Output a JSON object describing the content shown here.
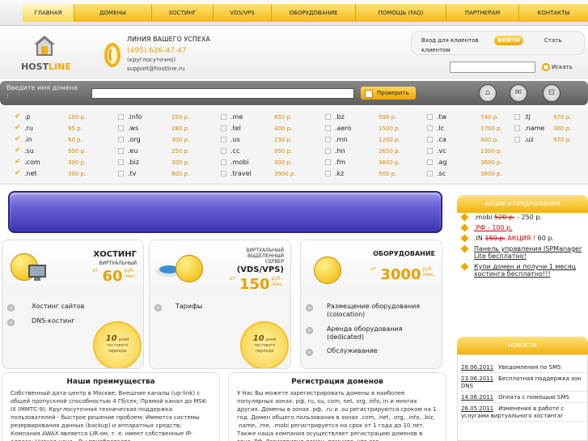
{
  "nav": {
    "items": [
      {
        "label": "ГЛАВНАЯ",
        "active": true
      },
      {
        "label": "ДОМЕНЫ"
      },
      {
        "label": "ХОСТИНГ"
      },
      {
        "label": "VDS/VPS"
      },
      {
        "label": "ОБОРУДОВАНИЕ"
      },
      {
        "label": "ПОМОЩЬ (FAQ)"
      },
      {
        "label": "ПАРТНЕРАМ"
      },
      {
        "label": "КОНТАКТЫ"
      }
    ]
  },
  "header": {
    "logo_text_a": "HOST",
    "logo_text_b": "LINE",
    "slogan": "ЛИНИЯ ВАШЕГО УСПЕХА",
    "phone": "(495) 626-47-47",
    "phone_note": "(круглосуточно)",
    "support_email": "support@hostline.ru",
    "login_label_1": "Вход для клиентов",
    "login_label_2": "клиентом",
    "login_button": "ВОЙТИ",
    "become_client": "Стать",
    "search_button": "Искать",
    "search_value": ""
  },
  "domain_check": {
    "placeholder_1": "Введите имя домена",
    "placeholder_2": ":",
    "check_button": "Проверить",
    "input_value": ""
  },
  "zones": [
    [
      {
        "name": ".p",
        "price": "100 р.",
        "checked": true
      },
      {
        "name": ".ru",
        "price": "95 р.",
        "checked": true
      },
      {
        "name": ".in",
        "price": "60 р.",
        "checked": true
      },
      {
        "name": ".su",
        "price": "950 р.",
        "checked": true
      },
      {
        "name": ".com",
        "price": "300 р.",
        "checked": true
      },
      {
        "name": ".net",
        "price": "300 р.",
        "checked": true
      }
    ],
    [
      {
        "name": ".info",
        "price": "250 р."
      },
      {
        "name": ".ws",
        "price": "280 р."
      },
      {
        "name": ".org",
        "price": "300 р."
      },
      {
        "name": ".eu",
        "price": "250 р."
      },
      {
        "name": ".biz",
        "price": "300 р."
      },
      {
        "name": ".tv",
        "price": "800 р."
      }
    ],
    [
      {
        "name": ".me",
        "price": "650 р."
      },
      {
        "name": ".tel",
        "price": "400 р."
      },
      {
        "name": ".us",
        "price": "230 р."
      },
      {
        "name": ".cc",
        "price": "950 р."
      },
      {
        "name": ".mobi",
        "price": "300 р."
      },
      {
        "name": ".travel",
        "price": "3900 р."
      }
    ],
    [
      {
        "name": ".bz",
        "price": "590 р."
      },
      {
        "name": ".aero",
        "price": "1500 р."
      },
      {
        "name": ".mn",
        "price": "1200 р."
      },
      {
        "name": ".hn",
        "price": "2650 р."
      },
      {
        "name": ".fm",
        "price": "3600 р."
      },
      {
        "name": ".kz",
        "price": "500 р."
      }
    ],
    [
      {
        "name": ".tw",
        "price": "740 р."
      },
      {
        "name": ".lc",
        "price": "1700 р."
      },
      {
        "name": ".ca",
        "price": "400 р."
      },
      {
        "name": ".vc",
        "price": "1300 р."
      },
      {
        "name": ".ag",
        "price": "3600 р."
      },
      {
        "name": ".sc",
        "price": "3600 р."
      }
    ],
    [
      {
        "name": ".tj",
        "price": "970 р."
      },
      {
        "name": ".name",
        "price": "300 р."
      },
      {
        "name": ".uz",
        "price": "970 р."
      }
    ]
  ],
  "products": {
    "hosting": {
      "title": "ХОСТИНГ",
      "sub": "ВИРТУАЛЬНЫЙ",
      "from": "от",
      "price": "60",
      "unit_1": "руб.",
      "unit_2": "/мес.",
      "links": [
        "Хостинг сайтов",
        "DNS-костинг"
      ],
      "badge_num": "10",
      "badge_text_1": "дней",
      "badge_text_2": "тестового",
      "badge_text_3": "периода"
    },
    "vds": {
      "sub_1": "ВИРТУАЛЬНЫЙ",
      "sub_2": "ВЫДЕЛЕННЫЙ",
      "sub_3": "СЕРВЕР",
      "title": "(VDS/VPS)",
      "from": "от",
      "price": "150",
      "unit_1": "руб.",
      "unit_2": "/мес.",
      "links": [
        "Тарифы"
      ],
      "badge_num": "10",
      "badge_text_1": "дней",
      "badge_text_2": "тестового",
      "badge_text_3": "периода"
    },
    "hardware": {
      "title": "ОБОРУДОВАНИЕ",
      "from": "от",
      "price": "3000",
      "unit_1": "руб.",
      "unit_2": "/мес.",
      "links": [
        "Размещение оборудования (colocation)",
        "Аренда оборудования (dedicated)",
        "Обслуживание"
      ]
    }
  },
  "promo": {
    "title": "АКЦИИ И ПРЕДЛОЖЕНИЯ",
    "items": [
      {
        "a": ".mobi",
        "old": "520 р.",
        "b": "- 250 р."
      },
      {
        "a": ".РФ - 100 р."
      },
      {
        "a": ".IN",
        "old": "150 р.",
        "red": "АКЦИЯ !",
        "b": "60 р."
      },
      {
        "a": "Панель управления ISPManager Lite бесплатно!"
      },
      {
        "a": "Купи домен и получи 1 месяц хостинга бесплатно!!!"
      }
    ]
  },
  "news": {
    "title": "НОВОСТИ",
    "items": [
      {
        "date": "28.06.2011",
        "text": "Уведомления по SMS"
      },
      {
        "date": "23.06.2011",
        "text": "Бесплатная поддержка зон DNS"
      },
      {
        "date": "14.06.2011",
        "text": "Оплата с помощью SMS"
      },
      {
        "date": "26.05.2011",
        "text": "Изменения в работе с услугами виртуального хостинга!"
      }
    ]
  },
  "advantages": {
    "title": "Наши преимущества",
    "text": "Собственный дата-центр в Москве; Внешние каналы (up-link) с общей пропускной способностью 4 Гб/сек; Прямой канал до MSK-IX (ММТС-9); Круглосуточная техническая поддержка пользователей - быстрое решение проблем; Имеются системы резервирования данных (backup) и аппаратных средств; Компания AWAX является LIR-ом, т. е. имеет собственные IP-адреса; Низкая цена - Вы приобретаете"
  },
  "registration": {
    "title": "Регистрация доменов",
    "text": "У Нас Вы можете зарегистрировать домены в наиболее популярных зонах: рф, ru, su, com, net, org, info, in и многих других. Домены в зонах .рф, .ru и .su регистрируются сроком на 1 год. Домен общего пользования в зонах .com, .net, .org, .info, .biz, .name, .me, .mobi регистрируется на срок от 1 года до 10 лет. Также наша компания осуществляет регистрацию доменов в зоне .РФ. Регистрируя домен, помните, что его"
  }
}
